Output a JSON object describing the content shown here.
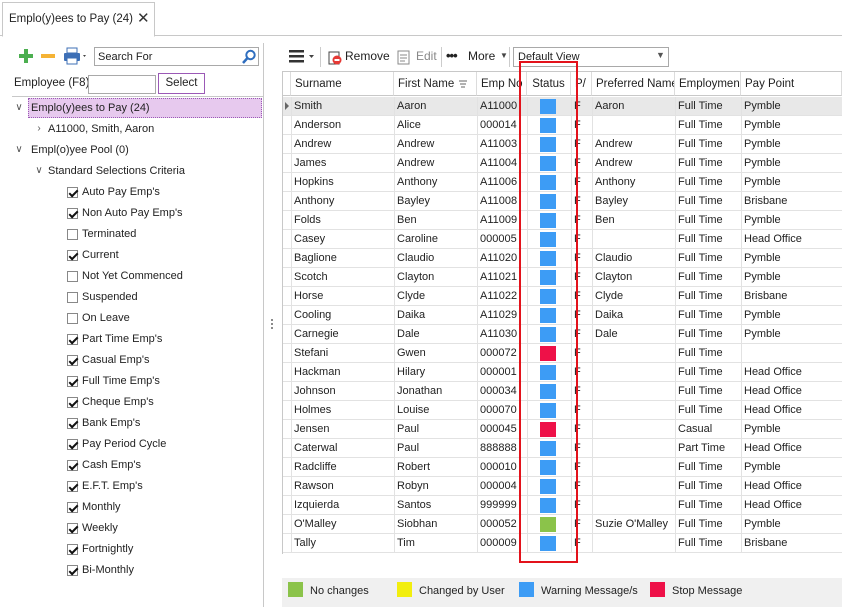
{
  "tab": {
    "title": "Emplo(y)ees to Pay (24)"
  },
  "left": {
    "search_placeholder": "Search For",
    "employee_label": "Employee (F8)",
    "employee_value": "",
    "select_label": "Select",
    "tree": {
      "root_selected": "Emplo(y)ees to Pay (24)",
      "child": "A11000, Smith, Aaron",
      "pool": "Empl(o)yee Pool (0)",
      "criteria": "Standard Selections Criteria",
      "options": [
        {
          "label": "Auto Pay Emp's",
          "checked": true
        },
        {
          "label": "Non Auto Pay Emp's",
          "checked": true
        },
        {
          "label": "Terminated",
          "checked": false
        },
        {
          "label": "Current",
          "checked": true
        },
        {
          "label": "Not Yet Commenced",
          "checked": false
        },
        {
          "label": "Suspended",
          "checked": false
        },
        {
          "label": "On Leave",
          "checked": false
        },
        {
          "label": "Part Time Emp's",
          "checked": true
        },
        {
          "label": "Casual Emp's",
          "checked": true
        },
        {
          "label": "Full Time Emp's",
          "checked": true
        },
        {
          "label": "Cheque Emp's",
          "checked": true
        },
        {
          "label": "Bank Emp's",
          "checked": true
        },
        {
          "label": "Pay Period Cycle",
          "checked": true
        },
        {
          "label": "Cash Emp's",
          "checked": true
        },
        {
          "label": "E.F.T. Emp's",
          "checked": true
        },
        {
          "label": "Monthly",
          "checked": true
        },
        {
          "label": "Weekly",
          "checked": true
        },
        {
          "label": "Fortnightly",
          "checked": true
        },
        {
          "label": "Bi-Monthly",
          "checked": true
        }
      ]
    }
  },
  "toolbar": {
    "remove_label": "Remove",
    "edit_label": "Edit",
    "more_label": "More",
    "view_value": "Default View"
  },
  "grid": {
    "columns": [
      "Surname",
      "First Name",
      "Emp No",
      "Status",
      "P/",
      "Preferred Name",
      "Employmen",
      "Pay Point"
    ],
    "rows": [
      {
        "surname": "Smith",
        "first": "Aaron",
        "emp": "A11000",
        "status": "warn",
        "p": "F",
        "pref": "Aaron",
        "employment": "Full Time",
        "paypoint": "Pymble"
      },
      {
        "surname": "Anderson",
        "first": "Alice",
        "emp": "000014",
        "status": "warn",
        "p": "F",
        "pref": "",
        "employment": "Full Time",
        "paypoint": "Pymble"
      },
      {
        "surname": "Andrew",
        "first": "Andrew",
        "emp": "A11003",
        "status": "warn",
        "p": "F",
        "pref": "Andrew",
        "employment": "Full Time",
        "paypoint": "Pymble"
      },
      {
        "surname": "James",
        "first": "Andrew",
        "emp": "A11004",
        "status": "warn",
        "p": "F",
        "pref": "Andrew",
        "employment": "Full Time",
        "paypoint": "Pymble"
      },
      {
        "surname": "Hopkins",
        "first": "Anthony",
        "emp": "A11006",
        "status": "warn",
        "p": "F",
        "pref": "Anthony",
        "employment": "Full Time",
        "paypoint": "Pymble"
      },
      {
        "surname": "Anthony",
        "first": "Bayley",
        "emp": "A11008",
        "status": "warn",
        "p": "F",
        "pref": "Bayley",
        "employment": "Full Time",
        "paypoint": "Brisbane"
      },
      {
        "surname": "Folds",
        "first": "Ben",
        "emp": "A11009",
        "status": "warn",
        "p": "F",
        "pref": "Ben",
        "employment": "Full Time",
        "paypoint": "Pymble"
      },
      {
        "surname": "Casey",
        "first": "Caroline",
        "emp": "000005",
        "status": "warn",
        "p": "F",
        "pref": "",
        "employment": "Full Time",
        "paypoint": "Head Office"
      },
      {
        "surname": "Baglione",
        "first": "Claudio",
        "emp": "A11020",
        "status": "warn",
        "p": "F",
        "pref": "Claudio",
        "employment": "Full Time",
        "paypoint": "Pymble"
      },
      {
        "surname": "Scotch",
        "first": "Clayton",
        "emp": "A11021",
        "status": "warn",
        "p": "F",
        "pref": "Clayton",
        "employment": "Full Time",
        "paypoint": "Pymble"
      },
      {
        "surname": "Horse",
        "first": "Clyde",
        "emp": "A11022",
        "status": "warn",
        "p": "F",
        "pref": "Clyde",
        "employment": "Full Time",
        "paypoint": "Brisbane"
      },
      {
        "surname": "Cooling",
        "first": "Daika",
        "emp": "A11029",
        "status": "warn",
        "p": "F",
        "pref": "Daika",
        "employment": "Full Time",
        "paypoint": "Pymble"
      },
      {
        "surname": "Carnegie",
        "first": "Dale",
        "emp": "A11030",
        "status": "warn",
        "p": "F",
        "pref": "Dale",
        "employment": "Full Time",
        "paypoint": "Pymble"
      },
      {
        "surname": "Stefani",
        "first": "Gwen",
        "emp": "000072",
        "status": "stop",
        "p": "F",
        "pref": "",
        "employment": "Full Time",
        "paypoint": ""
      },
      {
        "surname": "Hackman",
        "first": "Hilary",
        "emp": "000001",
        "status": "warn",
        "p": "F",
        "pref": "",
        "employment": "Full Time",
        "paypoint": "Head Office"
      },
      {
        "surname": "Johnson",
        "first": "Jonathan",
        "emp": "000034",
        "status": "warn",
        "p": "F",
        "pref": "",
        "employment": "Full Time",
        "paypoint": "Head Office"
      },
      {
        "surname": "Holmes",
        "first": "Louise",
        "emp": "000070",
        "status": "warn",
        "p": "F",
        "pref": "",
        "employment": "Full Time",
        "paypoint": "Head Office"
      },
      {
        "surname": "Jensen",
        "first": "Paul",
        "emp": "000045",
        "status": "stop",
        "p": "F",
        "pref": "",
        "employment": "Casual",
        "paypoint": "Pymble"
      },
      {
        "surname": "Caterwal",
        "first": "Paul",
        "emp": "888888",
        "status": "warn",
        "p": "F",
        "pref": "",
        "employment": "Part Time",
        "paypoint": "Head Office"
      },
      {
        "surname": "Radcliffe",
        "first": "Robert",
        "emp": "000010",
        "status": "warn",
        "p": "F",
        "pref": "",
        "employment": "Full Time",
        "paypoint": "Pymble"
      },
      {
        "surname": "Rawson",
        "first": "Robyn",
        "emp": "000004",
        "status": "warn",
        "p": "F",
        "pref": "",
        "employment": "Full Time",
        "paypoint": "Head Office"
      },
      {
        "surname": "Izquierda",
        "first": "Santos",
        "emp": "999999",
        "status": "warn",
        "p": "F",
        "pref": "",
        "employment": "Full Time",
        "paypoint": "Head Office"
      },
      {
        "surname": "O'Malley",
        "first": "Siobhan",
        "emp": "000052",
        "status": "ok",
        "p": "F",
        "pref": "Suzie O'Malley",
        "employment": "Full Time",
        "paypoint": "Pymble"
      },
      {
        "surname": "Tally",
        "first": "Tim",
        "emp": "000009",
        "status": "warn",
        "p": "F",
        "pref": "",
        "employment": "Full Time",
        "paypoint": "Brisbane"
      }
    ]
  },
  "legend": [
    {
      "key": "ok",
      "label": "No changes",
      "color": "#8bc34a"
    },
    {
      "key": "user",
      "label": "Changed by User",
      "color": "#f2ee0e"
    },
    {
      "key": "warn",
      "label": "Warning Message/s",
      "color": "#3d9cf5"
    },
    {
      "key": "stop",
      "label": "Stop Message",
      "color": "#ee1148"
    }
  ],
  "status_colors": {
    "ok": "#8bc34a",
    "user": "#f2ee0e",
    "warn": "#3d9cf5",
    "stop": "#ee1148"
  }
}
